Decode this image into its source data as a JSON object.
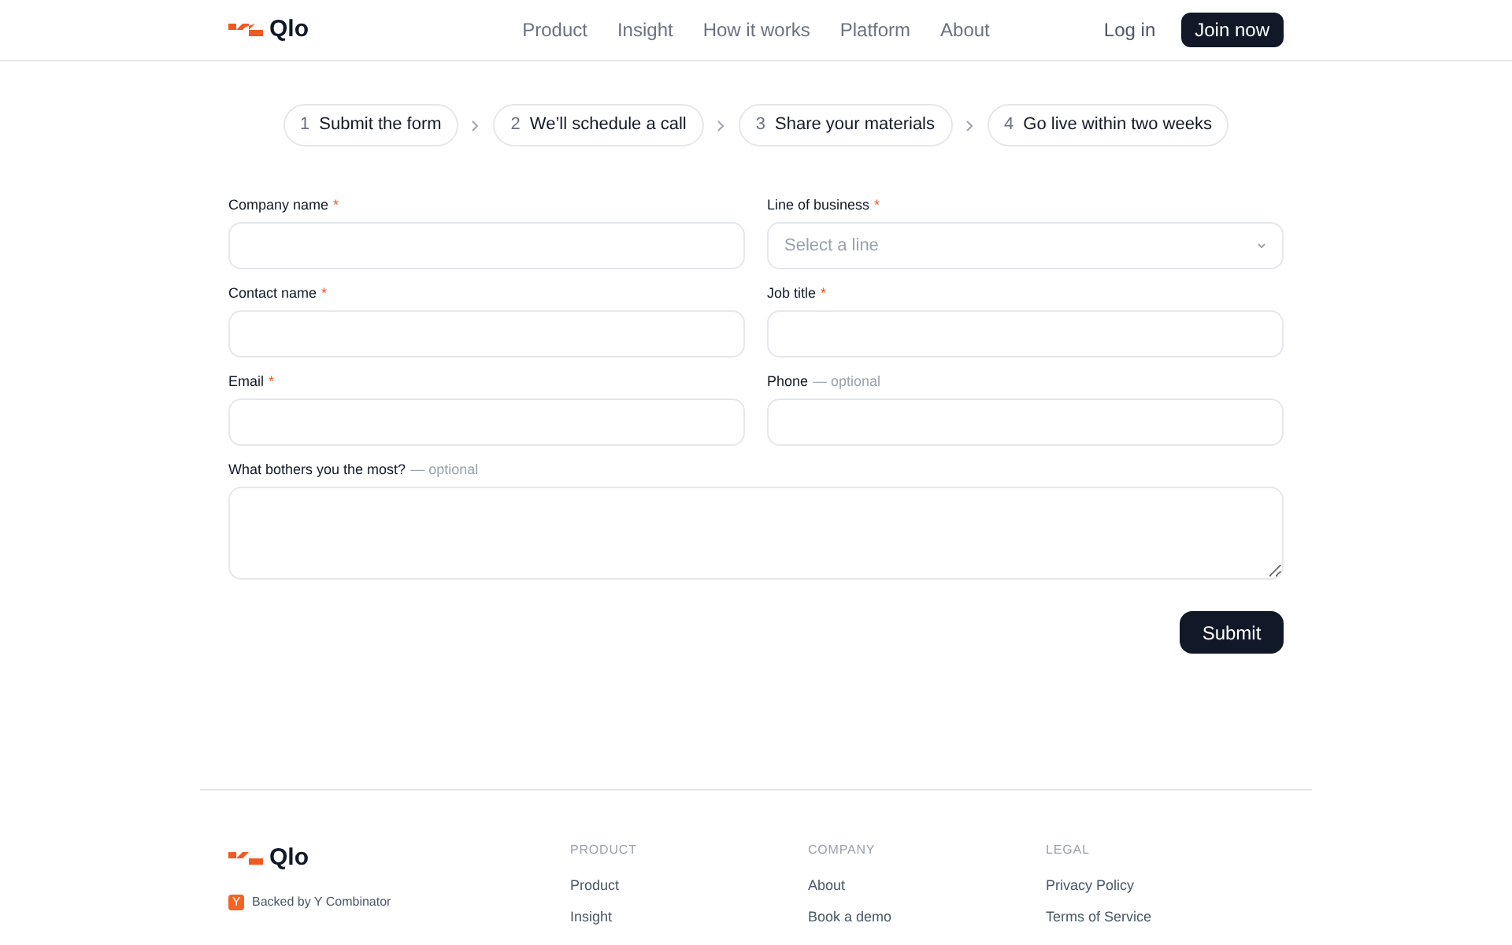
{
  "header": {
    "logo": "Qlo",
    "nav": [
      "Product",
      "Insight",
      "How it works",
      "Platform",
      "About"
    ],
    "login": "Log in",
    "cta": "Join now"
  },
  "steps": [
    {
      "number": "1",
      "label": "Submit the form"
    },
    {
      "number": "2",
      "label": "We’ll schedule a call"
    },
    {
      "number": "3",
      "label": "Share your materials"
    },
    {
      "number": "4",
      "label": "Go live within two weeks"
    }
  ],
  "form": {
    "fields": [
      {
        "kind": "input",
        "label": "Company name",
        "marker": "*"
      },
      {
        "kind": "select",
        "label": "Line of business",
        "marker": "*",
        "placeholder": "Select a line"
      },
      {
        "kind": "input",
        "label": "Contact name",
        "marker": "*"
      },
      {
        "kind": "input",
        "label": "Job title",
        "marker": "*"
      },
      {
        "kind": "input",
        "label": "Email",
        "marker": "*"
      },
      {
        "kind": "input",
        "label": "Phone",
        "note": "— optional"
      },
      {
        "kind": "textarea",
        "label": "What bothers you the most?",
        "note": "— optional"
      }
    ],
    "submit": "Submit"
  },
  "footer": {
    "logo": "Qlo",
    "badge": {
      "mark": "Y",
      "text": "Backed by Y Combinator"
    },
    "columns": [
      {
        "heading": "PRODUCT",
        "links": [
          "Product",
          "Insight"
        ]
      },
      {
        "heading": "COMPANY",
        "links": [
          "About",
          "Book a demo"
        ]
      },
      {
        "heading": "LEGAL",
        "links": [
          "Privacy Policy",
          "Terms of Service"
        ]
      }
    ]
  }
}
